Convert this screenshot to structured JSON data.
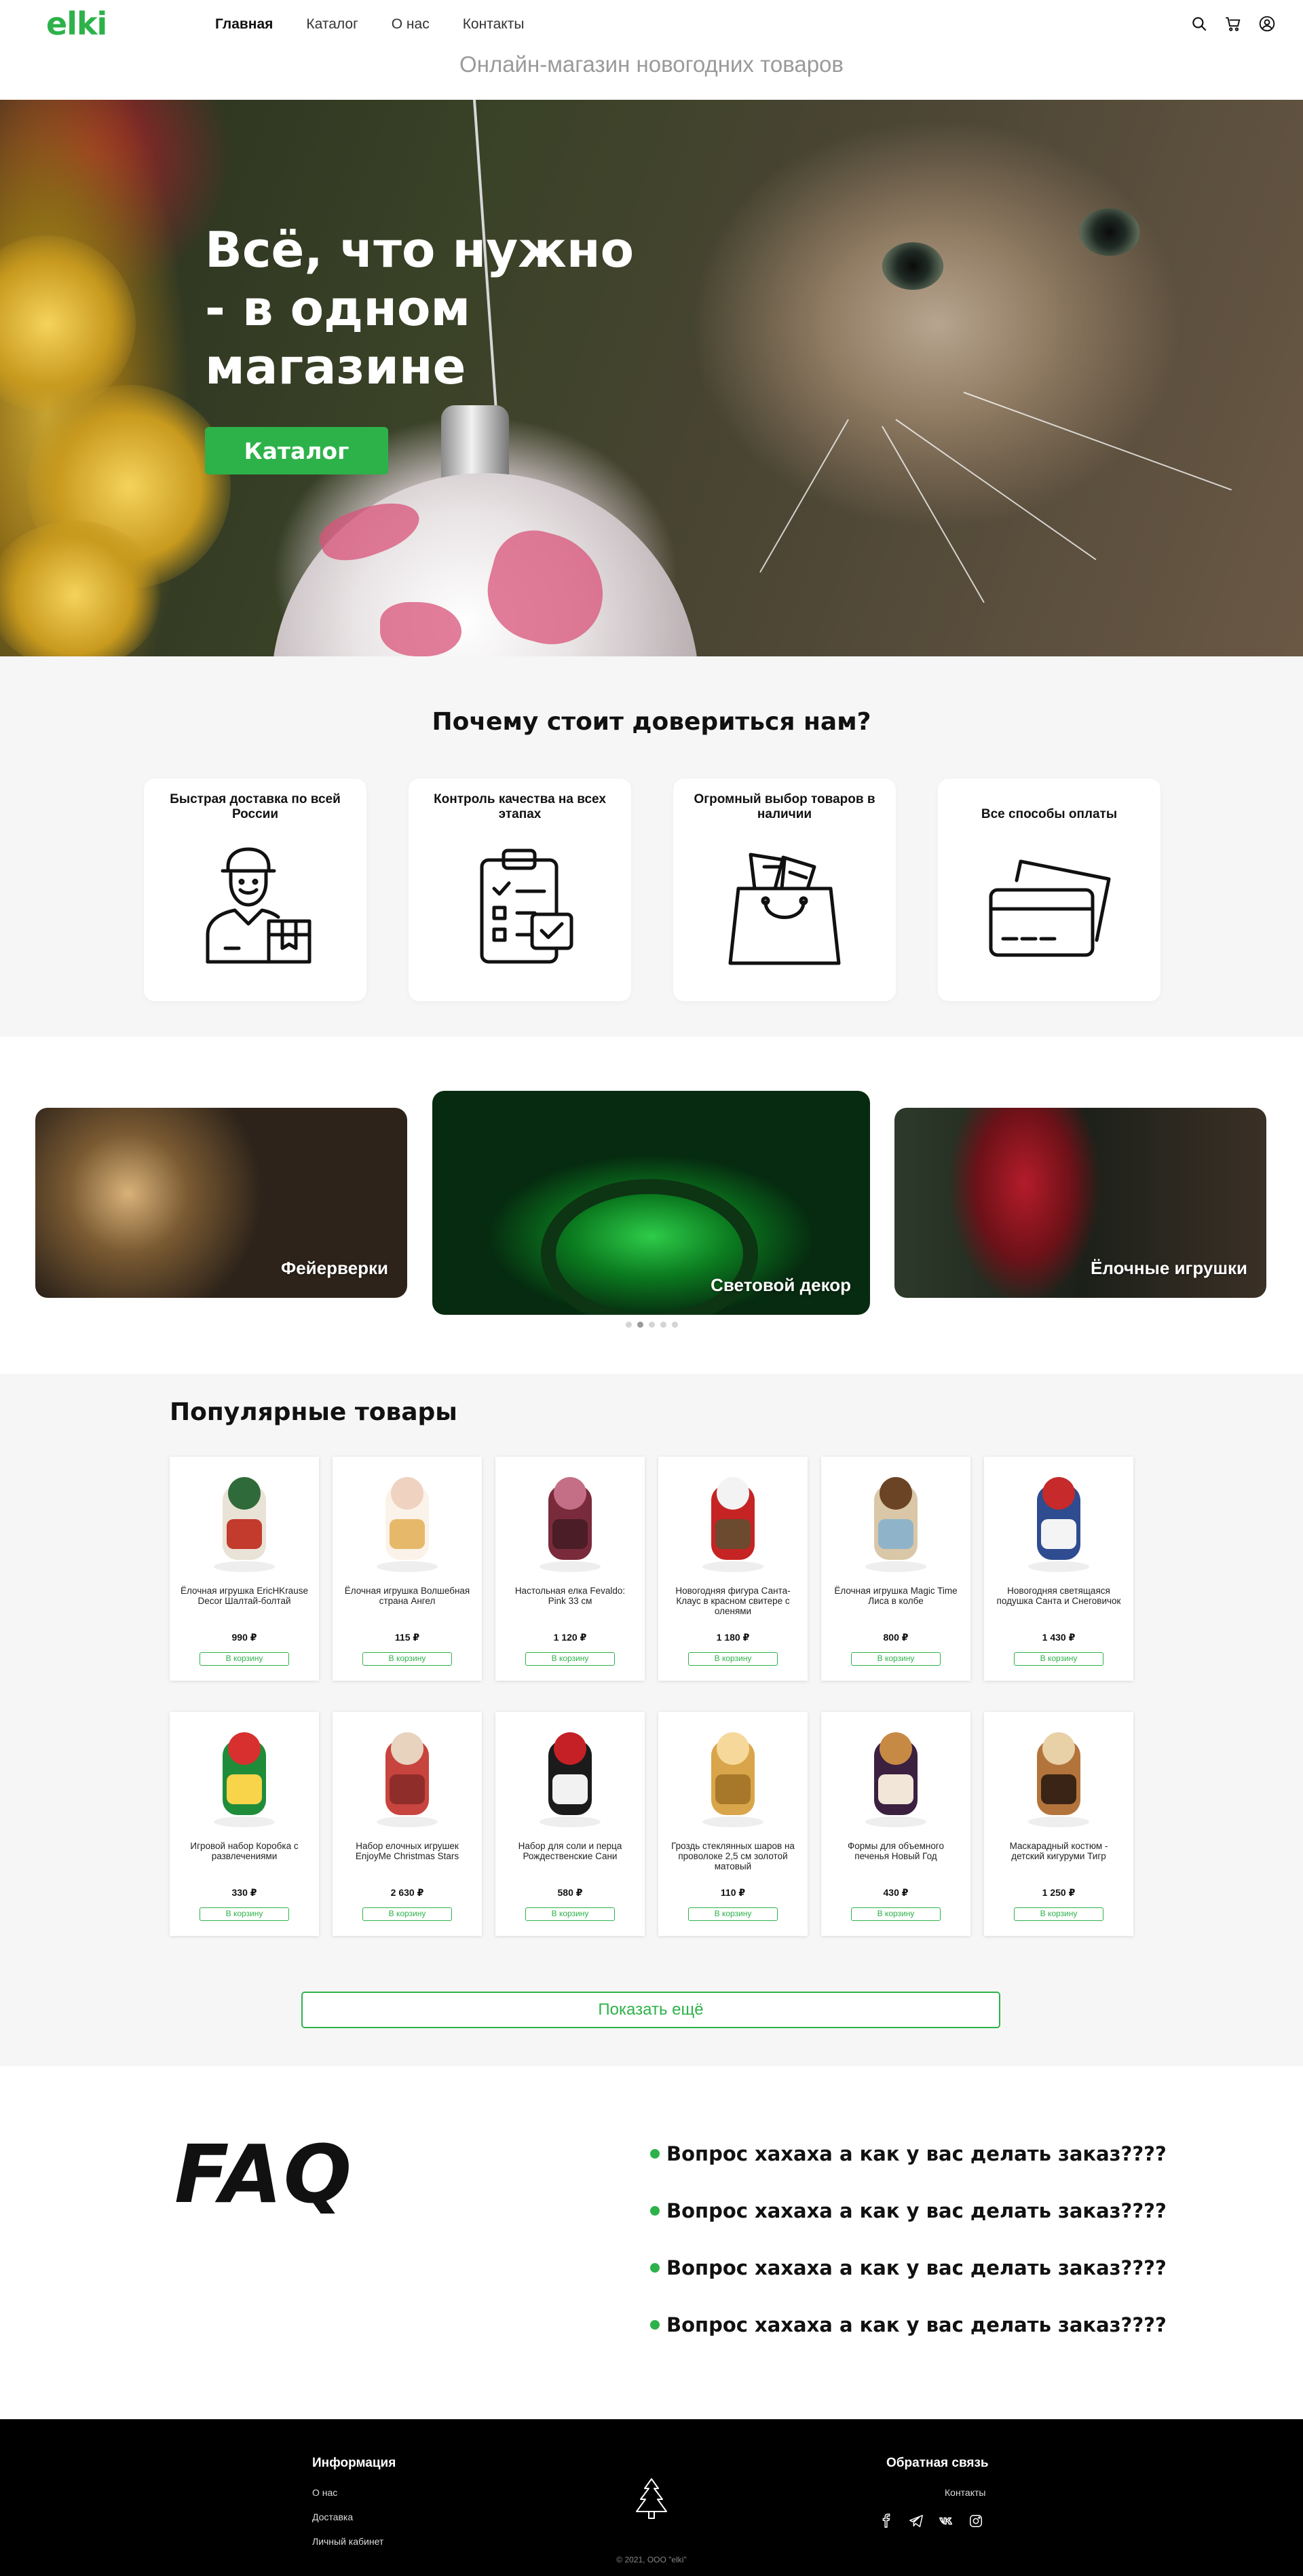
{
  "header": {
    "logo": "elki",
    "nav": [
      "Главная",
      "Каталог",
      "О нас",
      "Контакты"
    ],
    "tagline": "Онлайн-магазин новогодних товаров"
  },
  "hero": {
    "title": "Всё, что нужно - в одном магазине",
    "button": "Каталог"
  },
  "why": {
    "title": "Почему стоит довериться нам?",
    "cards": [
      {
        "title": "Быстрая доставка по всей России",
        "icon": "courier-icon"
      },
      {
        "title": "Контроль качества на всех этапах",
        "icon": "checklist-icon"
      },
      {
        "title": "Огромный выбор товаров в наличии",
        "icon": "shopping-bag-icon"
      },
      {
        "title": "Все способы оплаты",
        "icon": "credit-cards-icon"
      }
    ]
  },
  "carousel": {
    "slides": [
      "Фейерверки",
      "Световой декор",
      "Ёлочные игрушки"
    ],
    "dots": 5,
    "active_dot": 2
  },
  "products": {
    "title": "Популярные товары",
    "cart_label": "В корзину",
    "items": [
      {
        "name": "Ёлочная игрушка EricHKrause Decor Шалтай-болтай",
        "price": "990 ₽"
      },
      {
        "name": "Ёлочная игрушка Волшебная страна Ангел",
        "price": "115 ₽"
      },
      {
        "name": "Настольная елка Fevaldo: Pink 33 см",
        "price": "1 120 ₽"
      },
      {
        "name": "Новогодняя фигура Санта-Клаус в красном свитере с оленями",
        "price": "1 180 ₽"
      },
      {
        "name": "Ёлочная игрушка Magic Time Лиса в колбе",
        "price": "800 ₽"
      },
      {
        "name": "Новогодняя светящаяся подушка Санта и Снеговичок",
        "price": "1 430 ₽"
      },
      {
        "name": "Игровой набор Коробка с развлечениями",
        "price": "330 ₽"
      },
      {
        "name": "Набор елочных игрушек EnjoyMe Christmas Stars",
        "price": "2 630 ₽"
      },
      {
        "name": "Набор для соли и перца Рождественские Сани",
        "price": "580 ₽"
      },
      {
        "name": "Гроздь стеклянных шаров на проволоке 2,5 см золотой матовый",
        "price": "110 ₽"
      },
      {
        "name": "Формы для объемного печенья Новый Год",
        "price": "430 ₽"
      },
      {
        "name": "Маскарадный костюм - детский кигуруми Тигр",
        "price": "1 250 ₽"
      }
    ],
    "show_more": "Показать ещё"
  },
  "faq": {
    "title": "FAQ",
    "questions": [
      "Вопрос хахаха а как у вас делать заказ????",
      "Вопрос хахаха а как у вас делать заказ????",
      "Вопрос хахаха а как у вас делать заказ????",
      "Вопрос хахаха а как у вас делать заказ????"
    ]
  },
  "footer": {
    "info_title": "Информация",
    "info_links": [
      "О нас",
      "Доставка",
      "Личный кабинет"
    ],
    "feedback_title": "Обратная связь",
    "contacts": "Контакты",
    "social": [
      "facebook-icon",
      "telegram-icon",
      "vk-icon",
      "instagram-icon"
    ],
    "copyright": "© 2021, ООО \"elki\""
  },
  "colors": {
    "accent": "#2db24a",
    "footer_bg": "#000000",
    "section_bg": "#f6f6f6"
  }
}
